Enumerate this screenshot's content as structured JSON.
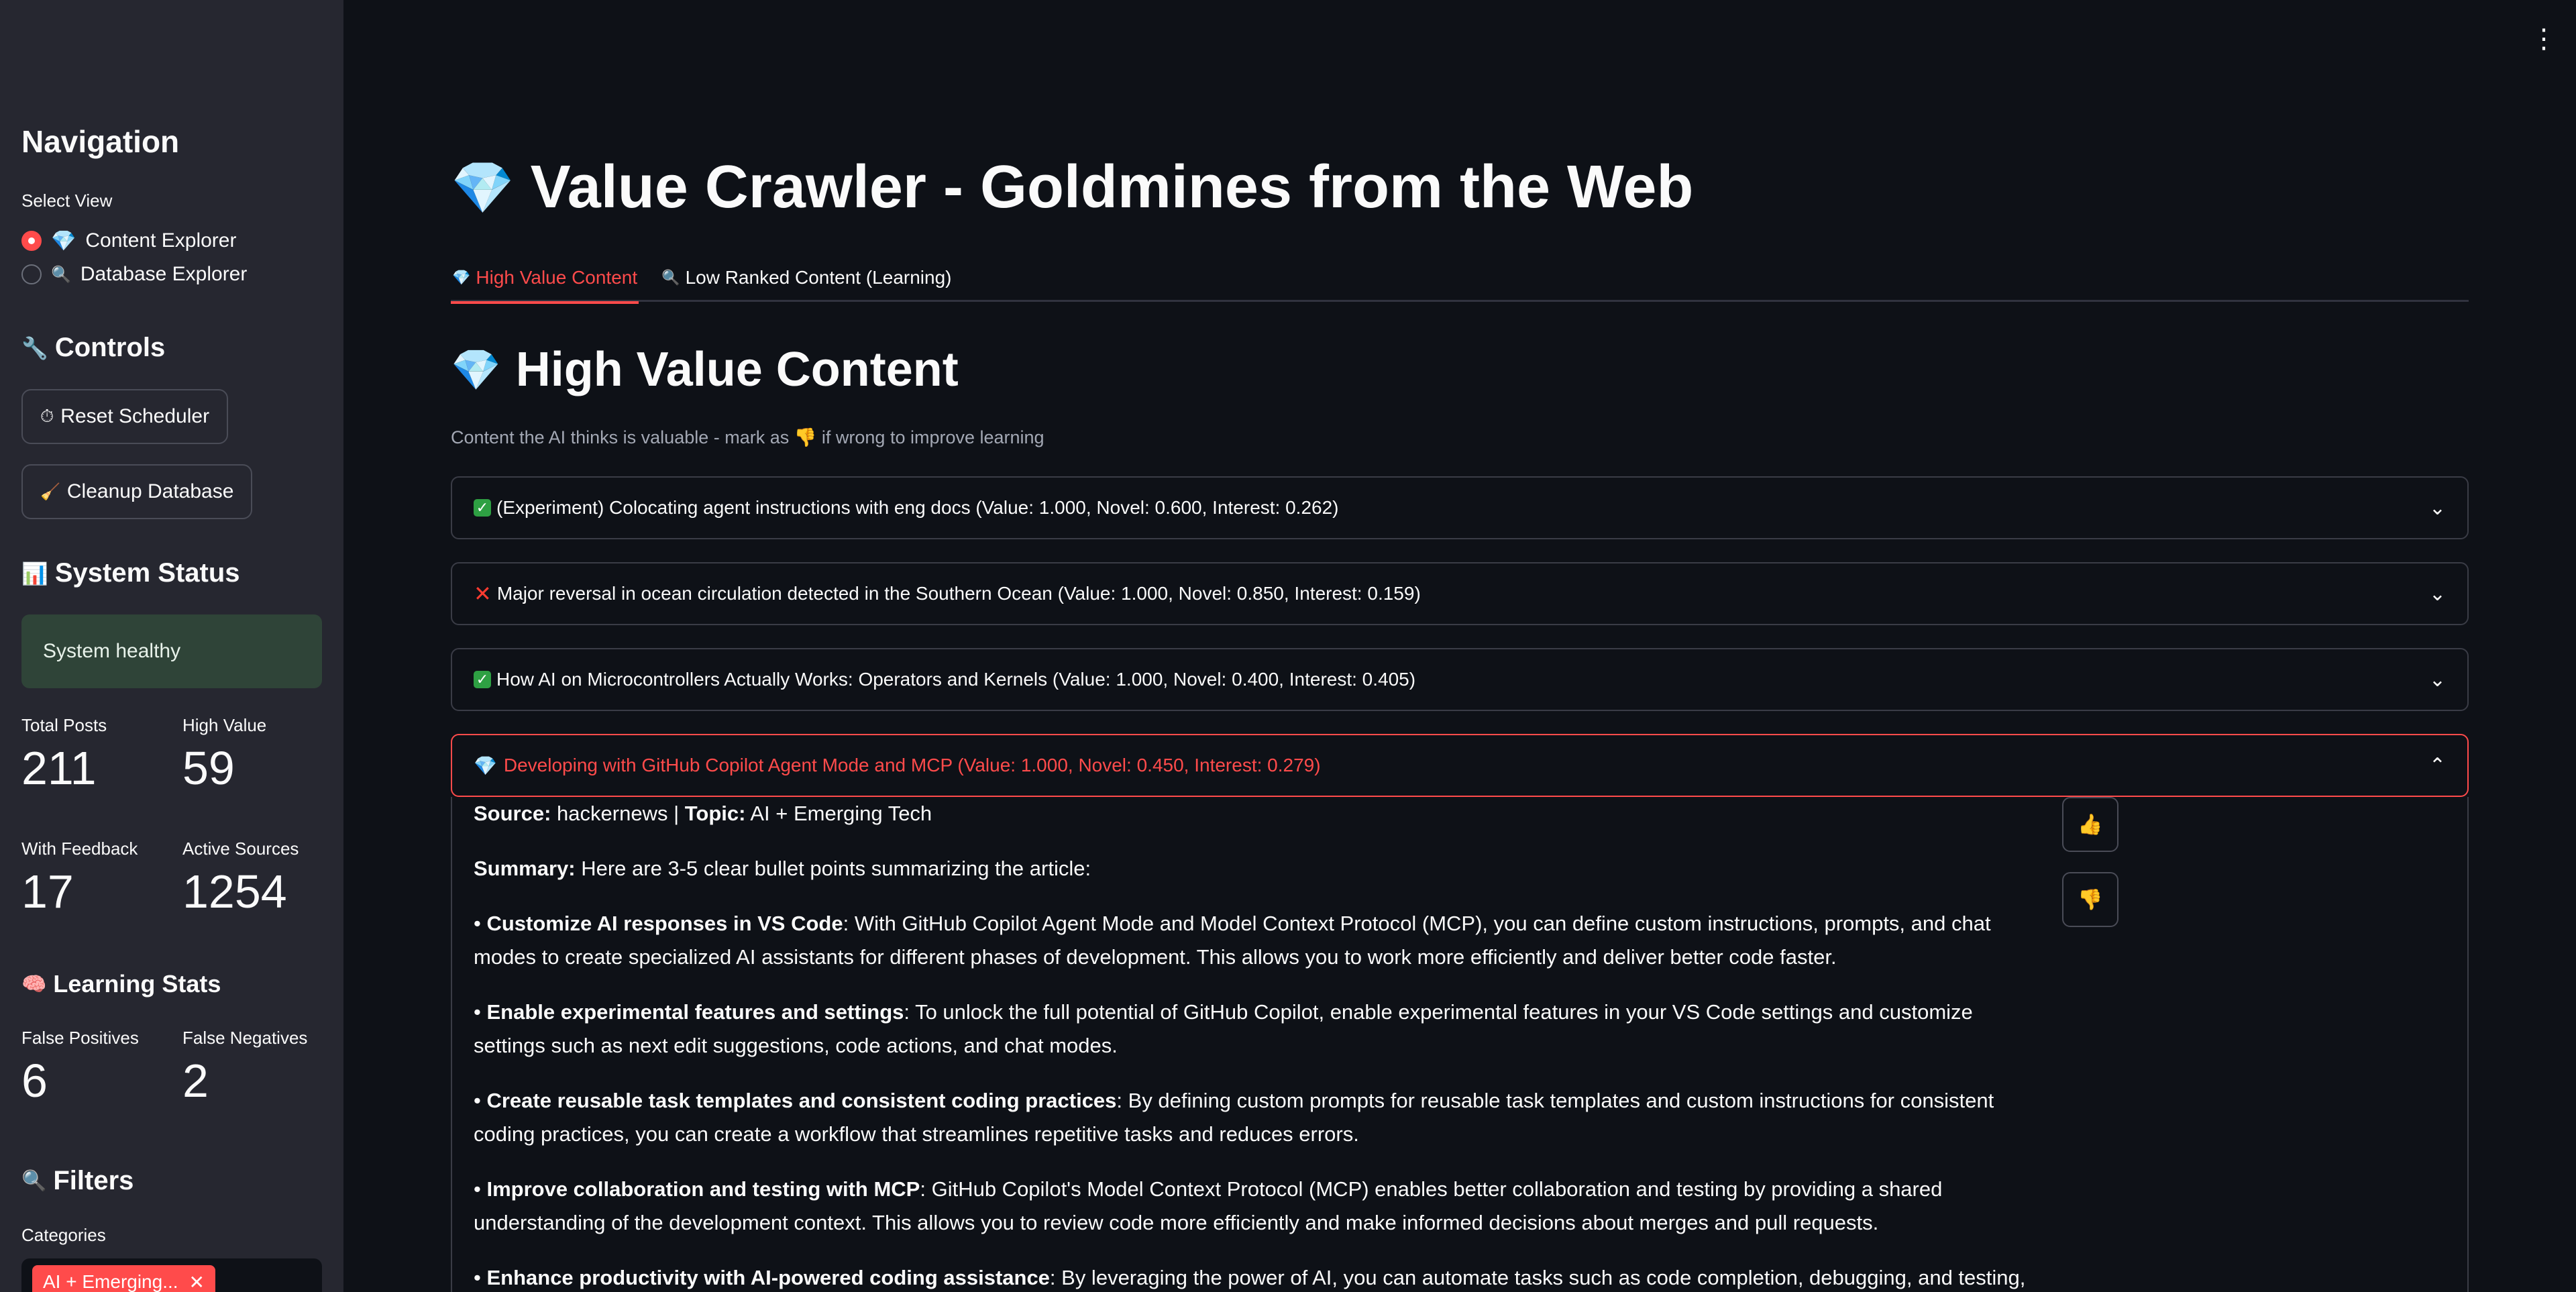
{
  "sidebar": {
    "nav_title": "Navigation",
    "select_view_label": "Select View",
    "views": [
      {
        "label": "Content Explorer",
        "selected": true
      },
      {
        "label": "Database Explorer",
        "selected": false
      }
    ],
    "controls_title": "Controls",
    "reset_button": "Reset Scheduler",
    "cleanup_button": "Cleanup Database",
    "system_status_title": "System Status",
    "system_status_text": "System healthy",
    "metrics": {
      "total_posts_label": "Total Posts",
      "total_posts": "211",
      "high_value_label": "High Value",
      "high_value": "59",
      "with_feedback_label": "With Feedback",
      "with_feedback": "17",
      "active_sources_label": "Active Sources",
      "active_sources": "1254"
    },
    "learning_title": "Learning Stats",
    "learning": {
      "false_pos_label": "False Positives",
      "false_pos": "6",
      "false_neg_label": "False Negatives",
      "false_neg": "2"
    },
    "filters_title": "Filters",
    "categories_label": "Categories",
    "category_chip": "AI + Emerging..."
  },
  "main": {
    "title": "Value Crawler - Goldmines from the Web",
    "tabs": [
      {
        "label": "High Value Content",
        "active": true
      },
      {
        "label": "Low Ranked Content (Learning)",
        "active": false
      }
    ],
    "section_title": "High Value Content",
    "caption_pre": "Content the AI thinks is valuable - mark as",
    "caption_post": "if wrong to improve learning",
    "items": [
      {
        "status": "check",
        "text": "(Experiment) Colocating agent instructions with eng docs (Value: 1.000, Novel: 0.600, Interest: 0.262)"
      },
      {
        "status": "cross",
        "text": "Major reversal in ocean circulation detected in the Southern Ocean (Value: 1.000, Novel: 0.850, Interest: 0.159)"
      },
      {
        "status": "check",
        "text": "How AI on Microcontrollers Actually Works: Operators and Kernels (Value: 1.000, Novel: 0.400, Interest: 0.405)"
      },
      {
        "status": "gem",
        "text": "Developing with GitHub Copilot Agent Mode and MCP (Value: 1.000, Novel: 0.450, Interest: 0.279)"
      }
    ],
    "expanded": {
      "source_label": "Source:",
      "source": "hackernews",
      "topic_label": "Topic:",
      "topic": "AI + Emerging Tech",
      "summary_label": "Summary:",
      "summary_intro": "Here are 3-5 clear bullet points summarizing the article:",
      "bullets": [
        {
          "title": "Customize AI responses in VS Code",
          "text": ": With GitHub Copilot Agent Mode and Model Context Protocol (MCP), you can define custom instructions, prompts, and chat modes to create specialized AI assistants for different phases of development. This allows you to work more efficiently and deliver better code faster."
        },
        {
          "title": "Enable experimental features and settings",
          "text": ": To unlock the full potential of GitHub Copilot, enable experimental features in your VS Code settings and customize settings such as next edit suggestions, code actions, and chat modes."
        },
        {
          "title": "Create reusable task templates and consistent coding practices",
          "text": ": By defining custom prompts for reusable task templates and custom instructions for consistent coding practices, you can create a workflow that streamlines repetitive tasks and reduces errors."
        },
        {
          "title": "Improve collaboration and testing with MCP",
          "text": ": GitHub Copilot's Model Context Protocol (MCP) enables better collaboration and testing by providing a shared understanding of the development context. This allows you to review code more efficiently and make informed decisions about merges and pull requests."
        },
        {
          "title": "Enhance productivity with AI-powered coding assistance",
          "text": ": By leveraging the power of AI, you can automate tasks such as code completion, debugging, and testing, freeing up"
        }
      ]
    }
  },
  "icons": {
    "gem": "gem-icon",
    "magnifier": "magnifier-icon",
    "wrench": "wrench-icon",
    "chart": "bar-chart-icon",
    "brain": "brain-icon",
    "thumbs_up": "thumbs-up-icon",
    "thumbs_down": "thumbs-down-icon"
  },
  "colors": {
    "accent": "#ff4b4b",
    "sidebar_bg": "#262730",
    "main_bg": "#0e1117",
    "status_bg": "#2f4438"
  }
}
